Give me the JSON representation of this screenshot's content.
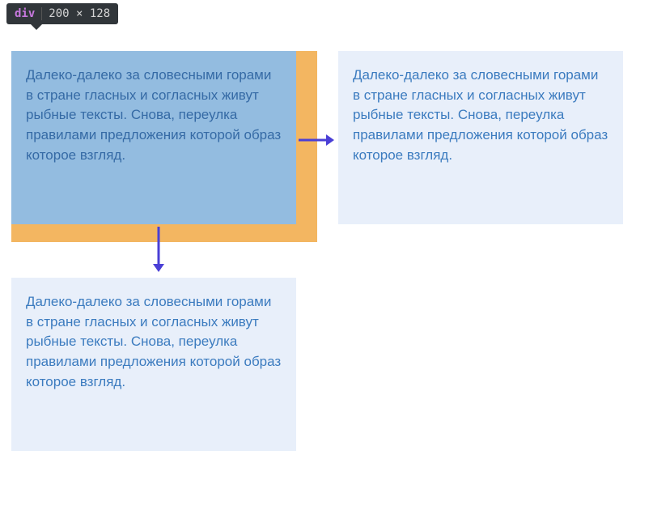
{
  "tooltip": {
    "tag": "div",
    "dimensions": "200 × 128"
  },
  "boxes": {
    "box1": "Далеко-далеко за словесными горами в стране гласных и согласных живут рыбные тексты. Снова, переулка правилами предложения которой образ которое взгляд.",
    "box2": "Далеко-далеко за словесными горами в стране гласных и согласных живут рыбные тексты. Снова, переулка правилами предложения которой образ которое взгляд.",
    "box3": "Далеко-далеко за словесными горами в стране гласных и согласных живут рыбные тексты. Снова, переулка правилами предложения которой образ которое взгляд."
  },
  "colors": {
    "tooltip_bg": "#31363a",
    "tag_color": "#c678dd",
    "margin_color": "#f3b661",
    "highlight_box": "#93bce0",
    "normal_box": "#e8effa",
    "text_color": "#3b7bbf",
    "arrow_color": "#4a3fd6"
  }
}
